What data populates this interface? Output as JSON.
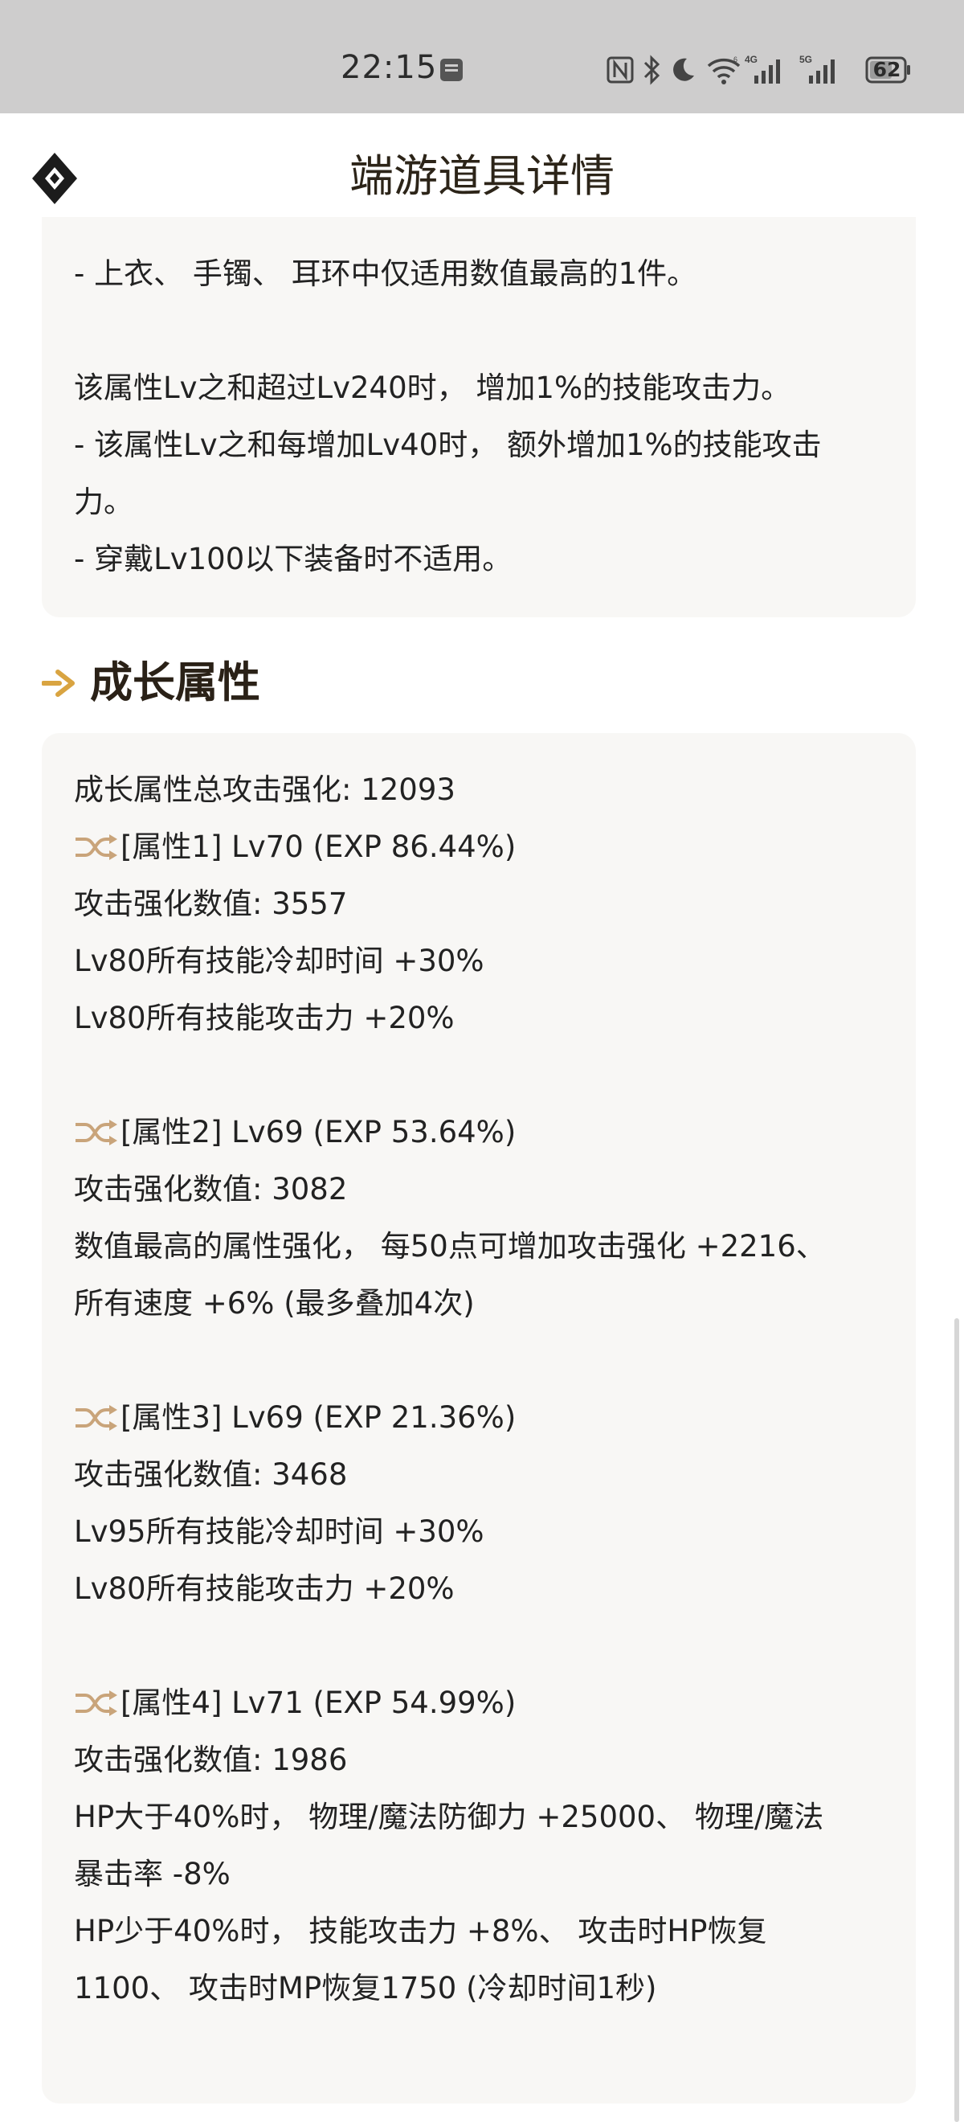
{
  "status_bar": {
    "time": "22:15",
    "battery": "62",
    "icons": [
      "sim-card-icon",
      "nfc-icon",
      "bluetooth-icon",
      "moon-icon",
      "wifi-icon",
      "signal-4g-icon",
      "signal-5g-icon",
      "battery-icon"
    ]
  },
  "header": {
    "title": "端游道具详情",
    "logo_icon": "diamond-logo-icon"
  },
  "top_card": {
    "lines": [
      "- 上衣、 手镯、 耳环中仅适用数值最高的1件。",
      "该属性Lv之和超过Lv240时， 增加1%的技能攻击力。",
      "- 该属性Lv之和每增加Lv40时， 额外增加1%的技能攻击",
      "力。",
      "- 穿戴Lv100以下装备时不适用。"
    ]
  },
  "growth_section": {
    "title": "成长属性",
    "heading_icon": "arrow-right-icon",
    "total": "成长属性总攻击强化: 12093",
    "attributes": [
      {
        "title": "[属性1] Lv70 (EXP 86.44%)",
        "lines": [
          "攻击强化数值:  3557",
          "Lv80所有技能冷却时间 +30%",
          "Lv80所有技能攻击力 +20%"
        ]
      },
      {
        "title": "[属性2] Lv69 (EXP 53.64%)",
        "lines": [
          "攻击强化数值:  3082",
          "数值最高的属性强化， 每50点可增加攻击强化 +2216、",
          "所有速度 +6% (最多叠加4次)"
        ]
      },
      {
        "title": "[属性3] Lv69 (EXP 21.36%)",
        "lines": [
          "攻击强化数值:  3468",
          "Lv95所有技能冷却时间 +30%",
          "Lv80所有技能攻击力 +20%"
        ]
      },
      {
        "title": "[属性4] Lv71 (EXP 54.99%)",
        "lines": [
          "攻击强化数值:  1986",
          "HP大于40%时， 物理/魔法防御力 +25000、 物理/魔法",
          "暴击率 -8%",
          "HP少于40%时， 技能攻击力 +8%、 攻击时HP恢复",
          "1100、 攻击时MP恢复1750 (冷却时间1秒)"
        ]
      }
    ],
    "attribute_icon": "shuffle-icon"
  },
  "colors": {
    "status_bar_bg": "#cecdcd",
    "card_bg": "#f8f7f5",
    "accent_gold": "#d9a441",
    "shuffle_icon": "#c9a47a"
  }
}
